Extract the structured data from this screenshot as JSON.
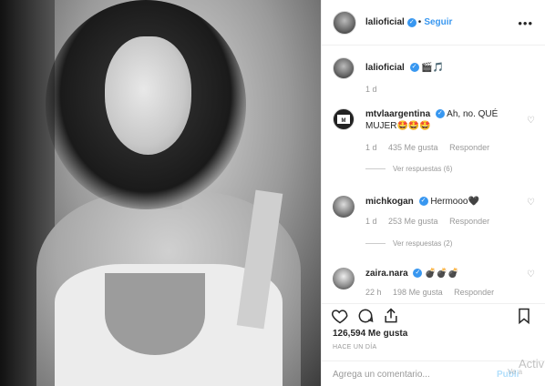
{
  "post": {
    "username": "lalioficial",
    "follow_label": "Seguir",
    "dot": "•",
    "more_icon": "more-horizontal-icon"
  },
  "caption": {
    "username": "lalioficial",
    "text": "🎬🎵",
    "age": "1 d"
  },
  "comments": [
    {
      "username": "mtvlaargentina",
      "text": "Ah, no. QUÉ MUJER🤩🤩🤩",
      "age": "1 d",
      "likes": "435 Me gusta",
      "reply_label": "Responder",
      "view_replies": "Ver respuestas (6)"
    },
    {
      "username": "michkogan",
      "text": "Hermooo🖤",
      "age": "1 d",
      "likes": "253 Me gusta",
      "reply_label": "Responder",
      "view_replies": "Ver respuestas (2)"
    },
    {
      "username": "zaira.nara",
      "text": "💣💣💣",
      "age": "22 h",
      "likes": "198 Me gusta",
      "reply_label": "Responder"
    }
  ],
  "actions": {
    "like_icon": "heart-icon",
    "comment_icon": "comment-icon",
    "share_icon": "share-icon",
    "save_icon": "bookmark-icon",
    "likes_count": "126,594 Me gusta",
    "timestamp": "HACE UN DÍA"
  },
  "add_comment": {
    "placeholder": "Agrega un comentario...",
    "publish_label": "Publi"
  },
  "watermark": {
    "line1": "Activ",
    "line2": "Ve a"
  },
  "colors": {
    "accent": "#3897f0",
    "muted": "#999999",
    "border": "#efefef"
  }
}
